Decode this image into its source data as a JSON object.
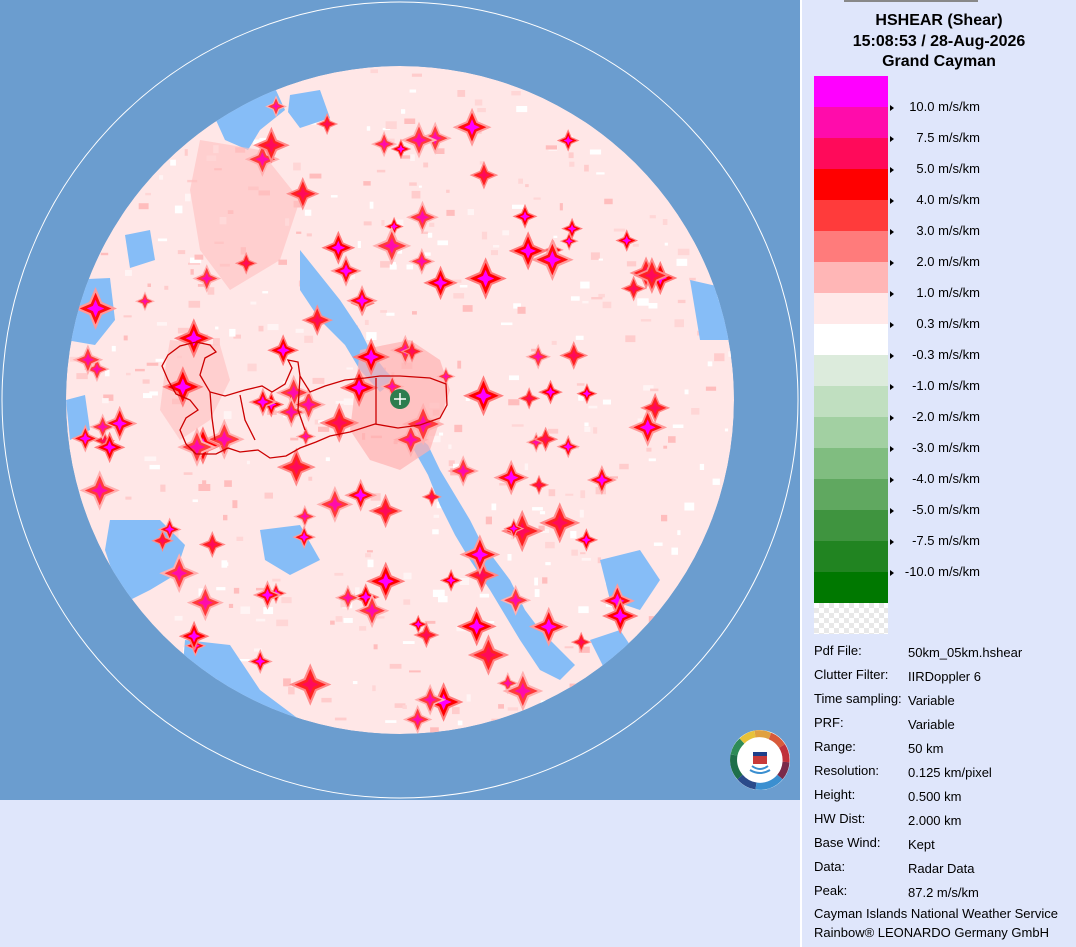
{
  "header": {
    "product": "HSHEAR (Shear)",
    "datetime": "15:08:53 / 28-Aug-2026",
    "site": "Grand Cayman"
  },
  "legend": {
    "unit": "m/s/km",
    "entries": [
      {
        "label": "10.0 m/s/km",
        "color": "#ff00ff"
      },
      {
        "label": "7.5 m/s/km",
        "color": "#ff0cab"
      },
      {
        "label": "5.0 m/s/km",
        "color": "#ff0a5a"
      },
      {
        "label": "4.0 m/s/km",
        "color": "#ff0000"
      },
      {
        "label": "3.0 m/s/km",
        "color": "#ff3b3b"
      },
      {
        "label": "2.0 m/s/km",
        "color": "#ff7b7b"
      },
      {
        "label": "1.0 m/s/km",
        "color": "#ffb6b6"
      },
      {
        "label": "0.3 m/s/km",
        "color": "#ffe9e9"
      },
      {
        "label": "-0.3 m/s/km",
        "color": "#ffffff"
      },
      {
        "label": "-1.0 m/s/km",
        "color": "#dcebdc"
      },
      {
        "label": "-2.0 m/s/km",
        "color": "#c0dfc0"
      },
      {
        "label": "-3.0 m/s/km",
        "color": "#a2d0a2"
      },
      {
        "label": "-4.0 m/s/km",
        "color": "#80bd80"
      },
      {
        "label": "-5.0 m/s/km",
        "color": "#60a860"
      },
      {
        "label": "-7.5 m/s/km",
        "color": "#3f943f"
      },
      {
        "label": "-10.0 m/s/km",
        "color": "#218421"
      },
      {
        "label": "",
        "color": "#007800"
      }
    ],
    "nodata_icon": "checkerboard-nodata"
  },
  "info": [
    {
      "key": "Pdf File:",
      "value": "50km_05km.hshear"
    },
    {
      "key": "Clutter Filter:",
      "value": "IIRDoppler 6"
    },
    {
      "key": "Time sampling:",
      "value": "Variable"
    },
    {
      "key": "PRF:",
      "value": "Variable"
    },
    {
      "key": "Range:",
      "value": "50 km"
    },
    {
      "key": "Resolution:",
      "value": "0.125 km/pixel"
    },
    {
      "key": "Height:",
      "value": "0.500 km"
    },
    {
      "key": "HW Dist:",
      "value": "2.000 km"
    },
    {
      "key": "Base Wind:",
      "value": "Kept"
    },
    {
      "key": "Data:",
      "value": "Radar Data"
    },
    {
      "key": "Peak:",
      "value": "87.2 m/s/km"
    }
  ],
  "credits": {
    "line1": "Cayman Islands National Weather Service",
    "line2": "Rainbow® LEONARDO Germany GmbH"
  },
  "colors": {
    "ocean": "#6b9dcf",
    "no_echo": "#86bdf7",
    "panel": "#dfe6fb",
    "coastline": "#cc0000",
    "radar_site": "#2e7d4f"
  },
  "icons": {
    "radar_site": "radar-site-crosshair-icon",
    "logo": "cayman-nws-logo"
  }
}
